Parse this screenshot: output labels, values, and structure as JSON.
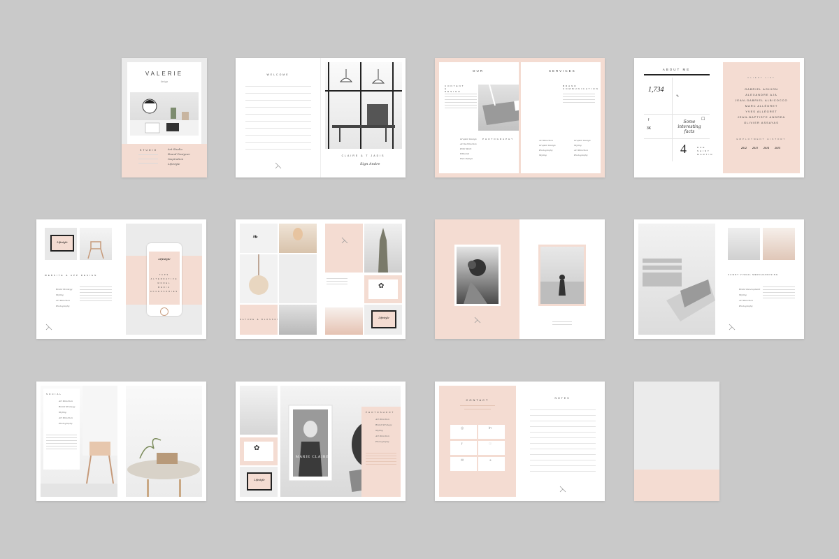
{
  "spread1": {
    "title": "VALERIE",
    "subtitle": "design",
    "section_label": "STUDIO",
    "items": [
      "Art Studio",
      "Brand Designer",
      "Inspiration",
      "Lifestyle"
    ]
  },
  "spread2": {
    "notes_title": "WELCOME",
    "caption": "CLAIRE & T JADIS",
    "signature": "Sign Andre"
  },
  "spread3": {
    "heading_left": "OUR",
    "heading_right": "SERVICES",
    "col_left_title": "CONTENT & DESIGN",
    "col_right_title": "BRAND COMMUNICATION",
    "mid_title": "PHOTOGRAPHY",
    "list_left": [
      "Graphic Design",
      "Art & Direction",
      "Print Work",
      "Editorial",
      "Web Design"
    ],
    "list_mid": [
      "Art Direction",
      "Graphic Design",
      "Photography",
      "Styling"
    ],
    "list_right": [
      "Graphic Design",
      "Styling",
      "Art Direction",
      "Photography"
    ]
  },
  "spread4": {
    "about_title": "ABOUT ME",
    "stat1": "1,734",
    "stat2": "3K",
    "stat3": "4",
    "script_text": "Some interesting facts",
    "address": "RUE SAINT MARTIN",
    "client_title": "CLIENT LIST",
    "clients": [
      "GABRIEL AGHION",
      "ALEXANDRE AJA",
      "JEAN-GABRIEL ALBICOCCO",
      "MARC ALLÉGRET",
      "YVES ALLÉGRET",
      "JEAN-BAPTISTE ANDREA",
      "OLIVIER ASSAYAS"
    ],
    "history_title": "EMPLOYMENT HISTORY",
    "years": [
      "2012",
      "2013",
      "2014",
      "2015"
    ]
  },
  "spread5": {
    "screen_logo": "Lifestyle",
    "phone_logo": "Lifestyle",
    "phone_menu": [
      "TAPS",
      "ALTERNATIVE",
      "MODEL",
      "MEDIA",
      "ACCESSORIES"
    ],
    "section_title": "WEBSITE & APP DESIGN",
    "list": [
      "Brand Strategy",
      "Styling",
      "Art Direction",
      "Photography"
    ]
  },
  "spread6": {
    "caption": "NATURE & BLOSSOM",
    "screen_logo": "Lifestyle"
  },
  "spread8": {
    "section_title": "CLIENT VISUAL MERCHANDISING",
    "list": [
      "Brand Development",
      "Styling",
      "Art Direction",
      "Photography"
    ]
  },
  "spread9": {
    "section_title": "SOCIAL",
    "list": [
      "Art Direction",
      "Brand Strategy",
      "Styling",
      "Art Direction",
      "Photography"
    ]
  },
  "spread10": {
    "section_title": "PHOTOSHOOT",
    "list": [
      "Art Direction",
      "Brand Strategy",
      "Styling",
      "Art Direction",
      "Photography"
    ],
    "magazine_title": "MARIE CLAIRE",
    "screen_logo": "Lifestyle"
  },
  "spread11": {
    "contact_title": "CONTACT",
    "notes_title": "NOTES"
  }
}
